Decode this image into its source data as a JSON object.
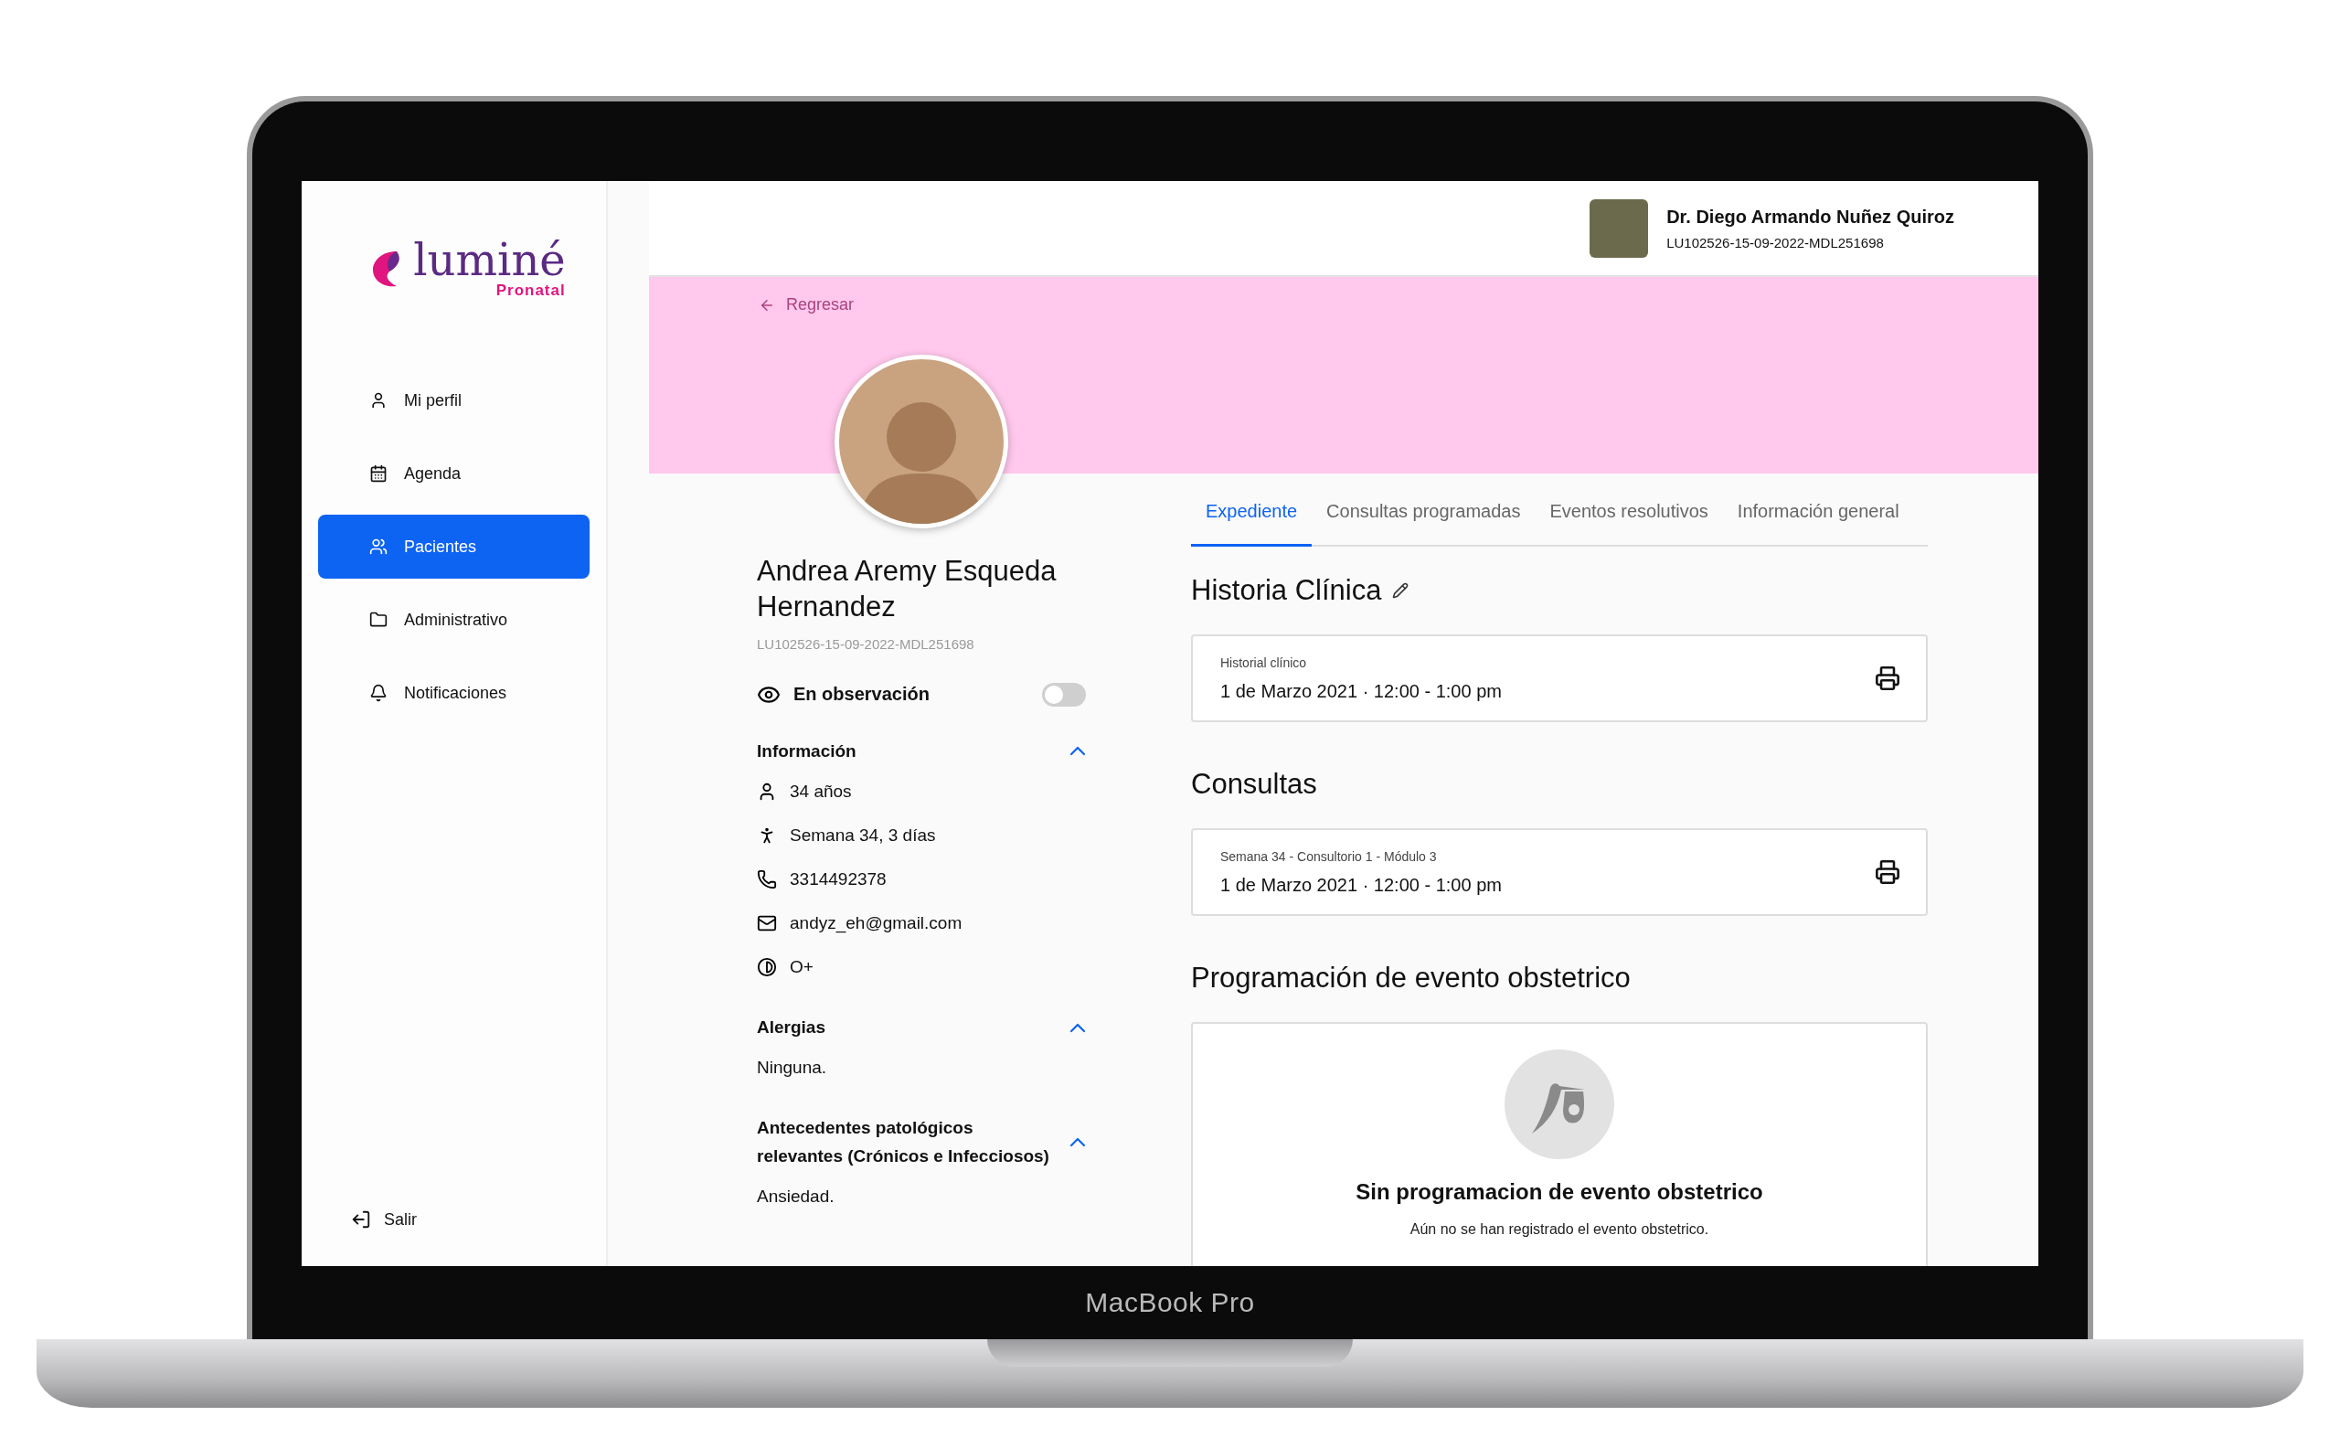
{
  "device": {
    "label": "MacBook Pro"
  },
  "logo": {
    "name": "luminé",
    "subtitle": "Pronatal"
  },
  "sidebar": {
    "items": [
      {
        "label": "Mi perfil",
        "kind": "profile",
        "selected": false
      },
      {
        "label": "Agenda",
        "kind": "calendar",
        "selected": false
      },
      {
        "label": "Pacientes",
        "kind": "patients",
        "selected": true
      },
      {
        "label": "Administrativo",
        "kind": "folder",
        "selected": false
      },
      {
        "label": "Notificaciones",
        "kind": "bell",
        "selected": false
      }
    ],
    "logout": "Salir"
  },
  "header": {
    "doctor_name": "Dr. Diego Armando Nuñez Quiroz",
    "doctor_id": "LU102526-15-09-2022-MDL251698"
  },
  "banner": {
    "back": "Regresar"
  },
  "patient": {
    "name": "Andrea Aremy Esqueda Hernandez",
    "id": "LU102526-15-09-2022-MDL251698",
    "observation": {
      "label": "En observación",
      "on": false
    },
    "sections": [
      {
        "title": "Información",
        "expanded": true,
        "items": [
          {
            "kind": "age",
            "text": "34 años"
          },
          {
            "kind": "pregnancy",
            "text": "Semana 34, 3 días"
          },
          {
            "kind": "phone",
            "text": "3314492378"
          },
          {
            "kind": "email",
            "text": "andyz_eh@gmail.com"
          },
          {
            "kind": "blood",
            "text": "O+"
          }
        ]
      },
      {
        "title": "Alergias",
        "expanded": true,
        "items": [
          {
            "kind": "plain",
            "text": "Ninguna."
          }
        ]
      },
      {
        "title": "Antecedentes patológicos relevantes (Crónicos e Infecciosos)",
        "expanded": true,
        "items": [
          {
            "kind": "plain",
            "text": "Ansiedad."
          }
        ]
      }
    ]
  },
  "tabs": [
    {
      "label": "Expediente",
      "selected": true
    },
    {
      "label": "Consultas programadas",
      "selected": false
    },
    {
      "label": "Eventos resolutivos",
      "selected": false
    },
    {
      "label": "Información general",
      "selected": false
    }
  ],
  "history": {
    "title": "Historia Clínica",
    "cards": [
      {
        "caption": "Historial clínico",
        "date": "1 de Marzo 2021 · 12:00 - 1:00 pm"
      }
    ]
  },
  "consultations": {
    "title": "Consultas",
    "cards": [
      {
        "caption": "Semana 34 - Consultorio 1 - Módulo 3",
        "date": "1 de Marzo 2021 · 12:00 - 1:00 pm"
      }
    ]
  },
  "obstetric": {
    "title": "Programación de evento obstetrico",
    "empty_title": "Sin programacion de evento obstetrico",
    "empty_text": "Aún no se han registrado el evento obstetrico."
  }
}
